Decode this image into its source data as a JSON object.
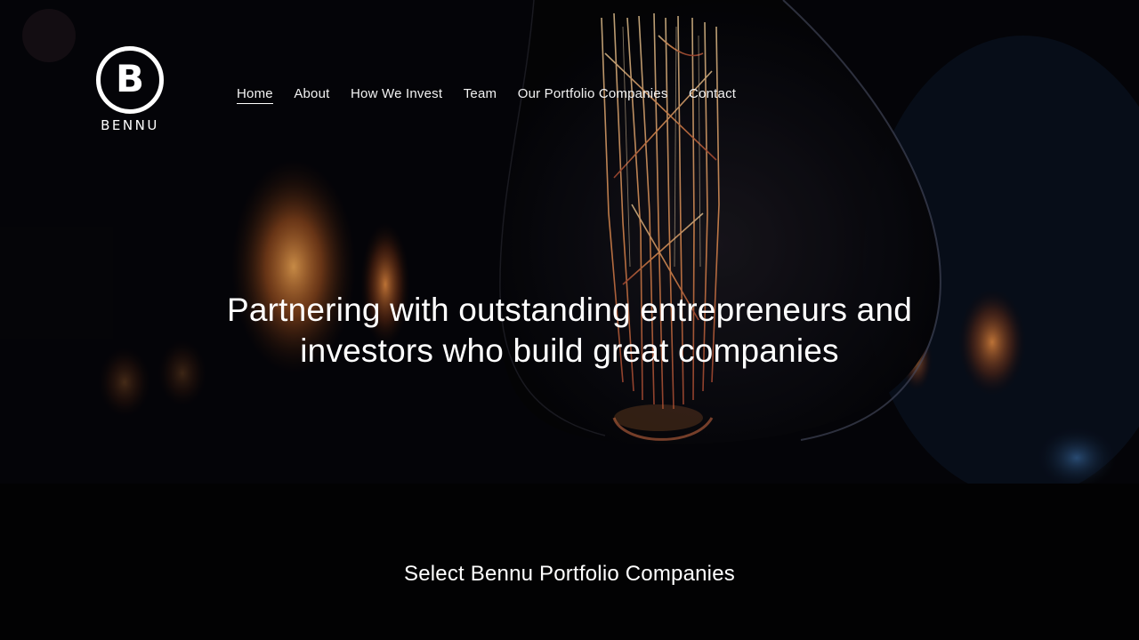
{
  "brand": {
    "logo_letter": "B",
    "logo_wordmark": "BENNU"
  },
  "nav": {
    "items": [
      {
        "label": "Home",
        "active": true
      },
      {
        "label": "About",
        "active": false
      },
      {
        "label": "How We Invest",
        "active": false
      },
      {
        "label": "Team",
        "active": false
      },
      {
        "label": "Our Portfolio Companies",
        "active": false
      },
      {
        "label": "Contact",
        "active": false
      }
    ]
  },
  "hero": {
    "headline_line1": "Partnering with outstanding entrepreneurs and",
    "headline_line2": "investors who build great companies",
    "background_description_icon": "edison-lightbulb-image"
  },
  "portfolio": {
    "title": "Select Bennu Portfolio Companies"
  },
  "colors": {
    "background": "#020203",
    "text": "#ffffff",
    "glow": "#ff9a3c"
  }
}
